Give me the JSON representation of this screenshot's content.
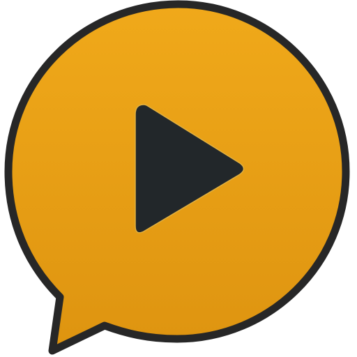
{
  "icon": {
    "name": "speech-bubble-play-icon",
    "symbol": "play-icon",
    "colors": {
      "bubble_fill_top": "#F0A91A",
      "bubble_fill_bottom": "#DE9410",
      "outline": "#272727",
      "play_fill": "#22272A",
      "play_highlight": "#E2B140"
    }
  }
}
